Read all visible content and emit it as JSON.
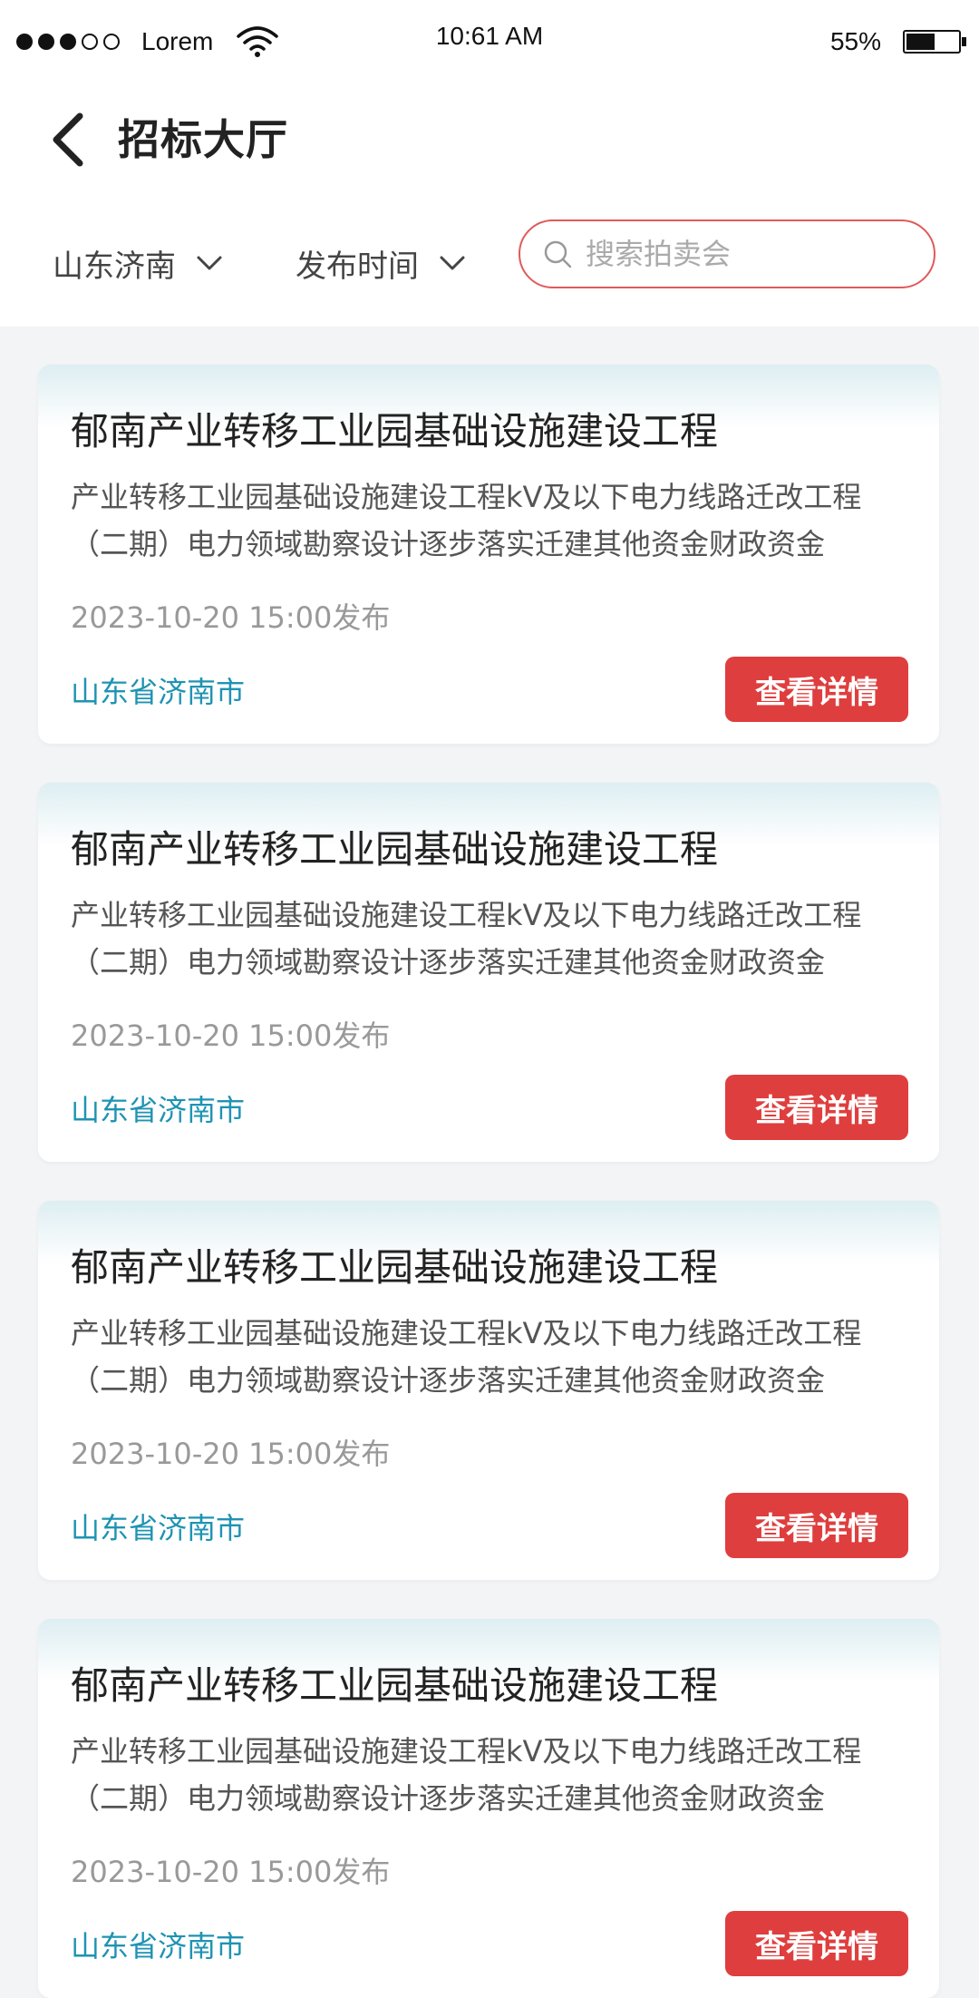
{
  "status_bar": {
    "carrier": "Lorem",
    "time": "10:61 AM",
    "battery_percent": "55%",
    "battery_level": 0.55,
    "signal_filled": 3,
    "signal_total": 5
  },
  "header": {
    "title": "招标大厅",
    "filters": {
      "region": "山东济南",
      "time": "发布时间"
    },
    "search": {
      "placeholder": "搜索拍卖会",
      "value": ""
    }
  },
  "listings": [
    {
      "title": "郁南产业转移工业园基础设施建设工程",
      "description": "产业转移工业园基础设施建设工程kV及以下电力线路迁改工程（二期）电力领域勘察设计逐步落实迁建其他资金财政资金",
      "date": "2023-10-20 15:00发布",
      "location": "山东省济南市",
      "button": "查看详情"
    },
    {
      "title": "郁南产业转移工业园基础设施建设工程",
      "description": "产业转移工业园基础设施建设工程kV及以下电力线路迁改工程（二期）电力领域勘察设计逐步落实迁建其他资金财政资金",
      "date": "2023-10-20 15:00发布",
      "location": "山东省济南市",
      "button": "查看详情"
    },
    {
      "title": "郁南产业转移工业园基础设施建设工程",
      "description": "产业转移工业园基础设施建设工程kV及以下电力线路迁改工程（二期）电力领域勘察设计逐步落实迁建其他资金财政资金",
      "date": "2023-10-20 15:00发布",
      "location": "山东省济南市",
      "button": "查看详情"
    },
    {
      "title": "郁南产业转移工业园基础设施建设工程",
      "description": "产业转移工业园基础设施建设工程kV及以下电力线路迁改工程（二期）电力领域勘察设计逐步落实迁建其他资金财政资金",
      "date": "2023-10-20 15:00发布",
      "location": "山东省济南市",
      "button": "查看详情"
    }
  ],
  "icons": {
    "back": "chevron-left-icon",
    "dropdown": "chevron-down-icon",
    "search": "search-icon",
    "wifi": "wifi-icon",
    "battery": "battery-icon"
  },
  "colors": {
    "accent": "#df3e3e",
    "search_border": "#e05a5a",
    "location_text": "#1f93b3",
    "card_gradient_top": "#ddeef2",
    "page_background": "#f3f4f6"
  }
}
